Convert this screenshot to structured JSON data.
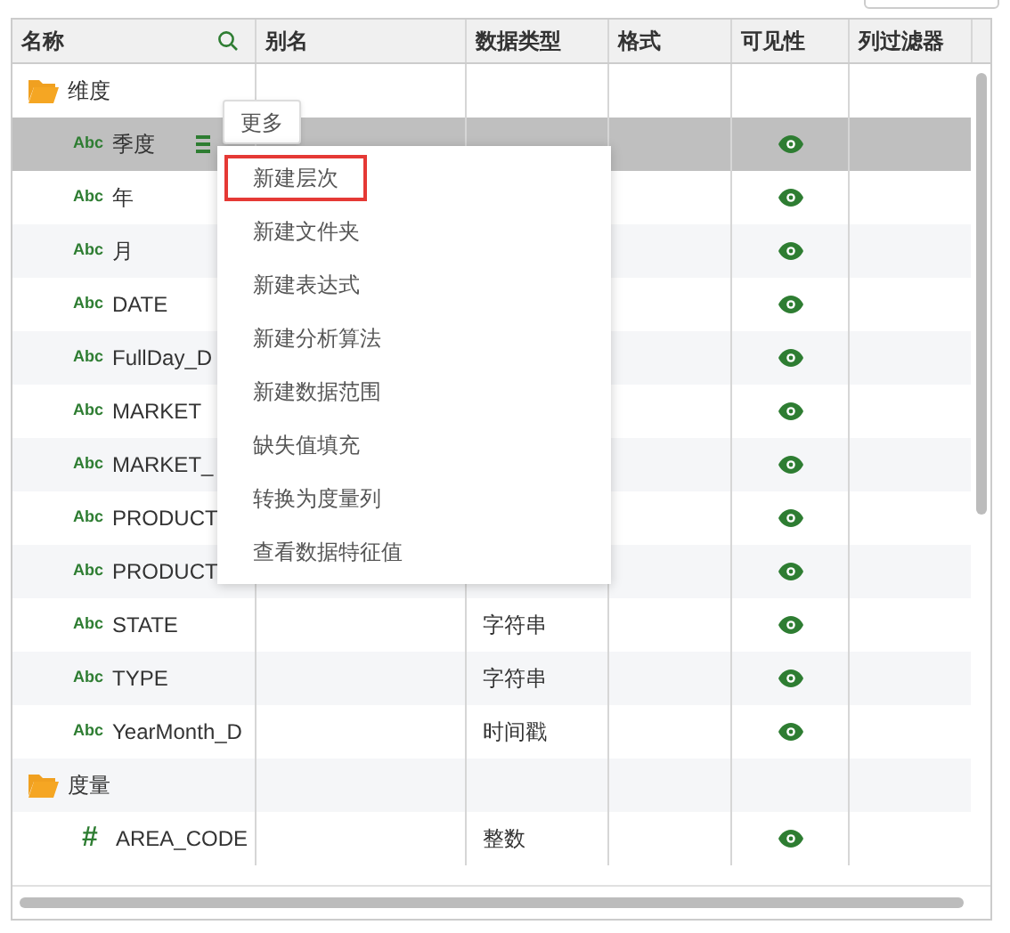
{
  "table": {
    "columns": [
      "名称",
      "别名",
      "数据类型",
      "格式",
      "可见性",
      "列过滤器"
    ],
    "rows": [
      {
        "kind": "folder",
        "name": "维度",
        "type": "",
        "visible": false,
        "selected": false
      },
      {
        "kind": "text",
        "badge": "Abc",
        "name": "季度",
        "type": "",
        "visible": true,
        "selected": true
      },
      {
        "kind": "text",
        "badge": "Abc",
        "name": "年",
        "type": "",
        "visible": true,
        "selected": false
      },
      {
        "kind": "text",
        "badge": "Abc",
        "name": "月",
        "type": "",
        "visible": true,
        "selected": false
      },
      {
        "kind": "text",
        "badge": "Abc",
        "name": "DATE",
        "type": "",
        "visible": true,
        "selected": false
      },
      {
        "kind": "text",
        "badge": "Abc",
        "name": "FullDay_D",
        "type": "",
        "visible": true,
        "selected": false
      },
      {
        "kind": "text",
        "badge": "Abc",
        "name": "MARKET",
        "type": "",
        "visible": true,
        "selected": false
      },
      {
        "kind": "text",
        "badge": "Abc",
        "name": "MARKET_",
        "type": "",
        "visible": true,
        "selected": false
      },
      {
        "kind": "text",
        "badge": "Abc",
        "name": "PRODUCT",
        "type": "",
        "visible": true,
        "selected": false
      },
      {
        "kind": "text",
        "badge": "Abc",
        "name": "PRODUCT",
        "type": "",
        "visible": true,
        "selected": false
      },
      {
        "kind": "text",
        "badge": "Abc",
        "name": "STATE",
        "type": "字符串",
        "visible": true,
        "selected": false
      },
      {
        "kind": "text",
        "badge": "Abc",
        "name": "TYPE",
        "type": "字符串",
        "visible": true,
        "selected": false
      },
      {
        "kind": "text",
        "badge": "Abc",
        "name": "YearMonth_D",
        "type": "时间戳",
        "visible": true,
        "selected": false
      },
      {
        "kind": "folder",
        "name": "度量",
        "type": "",
        "visible": false,
        "selected": false
      },
      {
        "kind": "number",
        "badge": "#",
        "name": "AREA_CODE",
        "type": "整数",
        "visible": true,
        "selected": false
      }
    ]
  },
  "tooltip": "更多",
  "menu": [
    {
      "label": "新建层次",
      "selected": true
    },
    {
      "label": "新建文件夹",
      "selected": false
    },
    {
      "label": "新建表达式",
      "selected": false
    },
    {
      "label": "新建分析算法",
      "selected": false
    },
    {
      "label": "新建数据范围",
      "selected": false
    },
    {
      "label": "缺失值填充",
      "selected": false
    },
    {
      "label": "转换为度量列",
      "selected": false
    },
    {
      "label": "查看数据特征值",
      "selected": false
    }
  ]
}
